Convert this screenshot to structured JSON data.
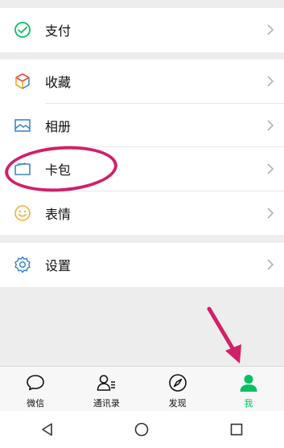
{
  "menu": {
    "pay": {
      "label": "支付",
      "icon": "pay-icon"
    },
    "favorites": {
      "label": "收藏",
      "icon": "cube-icon"
    },
    "album": {
      "label": "相册",
      "icon": "image-icon"
    },
    "cards": {
      "label": "卡包",
      "icon": "card-wallet-icon"
    },
    "stickers": {
      "label": "表情",
      "icon": "smiley-icon"
    },
    "settings": {
      "label": "设置",
      "icon": "gear-icon"
    }
  },
  "tabs": [
    {
      "label": "微信",
      "icon": "chat-bubble-icon",
      "active": false
    },
    {
      "label": "通讯录",
      "icon": "contacts-icon",
      "active": false
    },
    {
      "label": "发现",
      "icon": "compass-icon",
      "active": false
    },
    {
      "label": "我",
      "icon": "person-icon",
      "active": true
    }
  ],
  "system_nav": [
    "back-icon",
    "home-icon",
    "recents-icon"
  ],
  "colors": {
    "accent_green": "#07c160",
    "highlight_magenta": "#d1206a",
    "background": "#ededed",
    "settings_blue": "#4a90c2"
  }
}
